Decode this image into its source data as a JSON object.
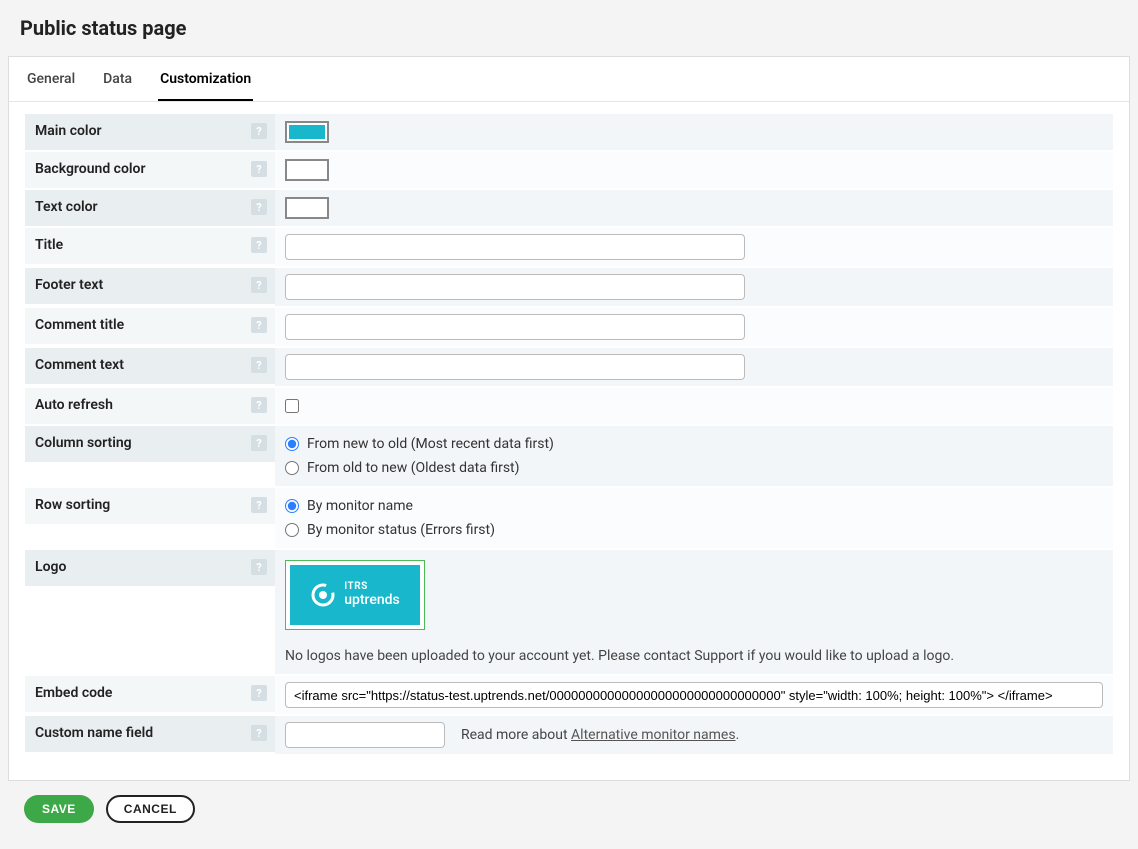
{
  "page": {
    "title": "Public status page"
  },
  "tabs": {
    "general": "General",
    "data": "Data",
    "customization": "Customization"
  },
  "fields": {
    "main_color": {
      "label": "Main color",
      "value": "#19b7cc"
    },
    "background_color": {
      "label": "Background color",
      "value": "#ffffff"
    },
    "text_color": {
      "label": "Text color",
      "value": "#ffffff"
    },
    "title": {
      "label": "Title",
      "value": ""
    },
    "footer_text": {
      "label": "Footer text",
      "value": ""
    },
    "comment_title": {
      "label": "Comment title",
      "value": ""
    },
    "comment_text": {
      "label": "Comment text",
      "value": ""
    },
    "auto_refresh": {
      "label": "Auto refresh",
      "checked": false
    },
    "column_sorting": {
      "label": "Column sorting",
      "options": {
        "new_to_old": "From new to old (Most recent data first)",
        "old_to_new": "From old to new (Oldest data first)"
      },
      "selected": "new_to_old"
    },
    "row_sorting": {
      "label": "Row sorting",
      "options": {
        "by_name": "By monitor name",
        "by_status": "By monitor status (Errors first)"
      },
      "selected": "by_name"
    },
    "logo": {
      "label": "Logo",
      "brand_top": "ITRS",
      "brand_bottom": "uptrends",
      "hint": "No logos have been uploaded to your account yet. Please contact Support if you would like to upload a logo."
    },
    "embed_code": {
      "label": "Embed code",
      "value": "<iframe src=\"https://status-test.uptrends.net/00000000000000000000000000000000\" style=\"width: 100%; height: 100%\"> </iframe>"
    },
    "custom_name": {
      "label": "Custom name field",
      "value": "",
      "note_prefix": "Read more about ",
      "note_link": "Alternative monitor names",
      "note_suffix": "."
    }
  },
  "buttons": {
    "save": "SAVE",
    "cancel": "CANCEL"
  }
}
